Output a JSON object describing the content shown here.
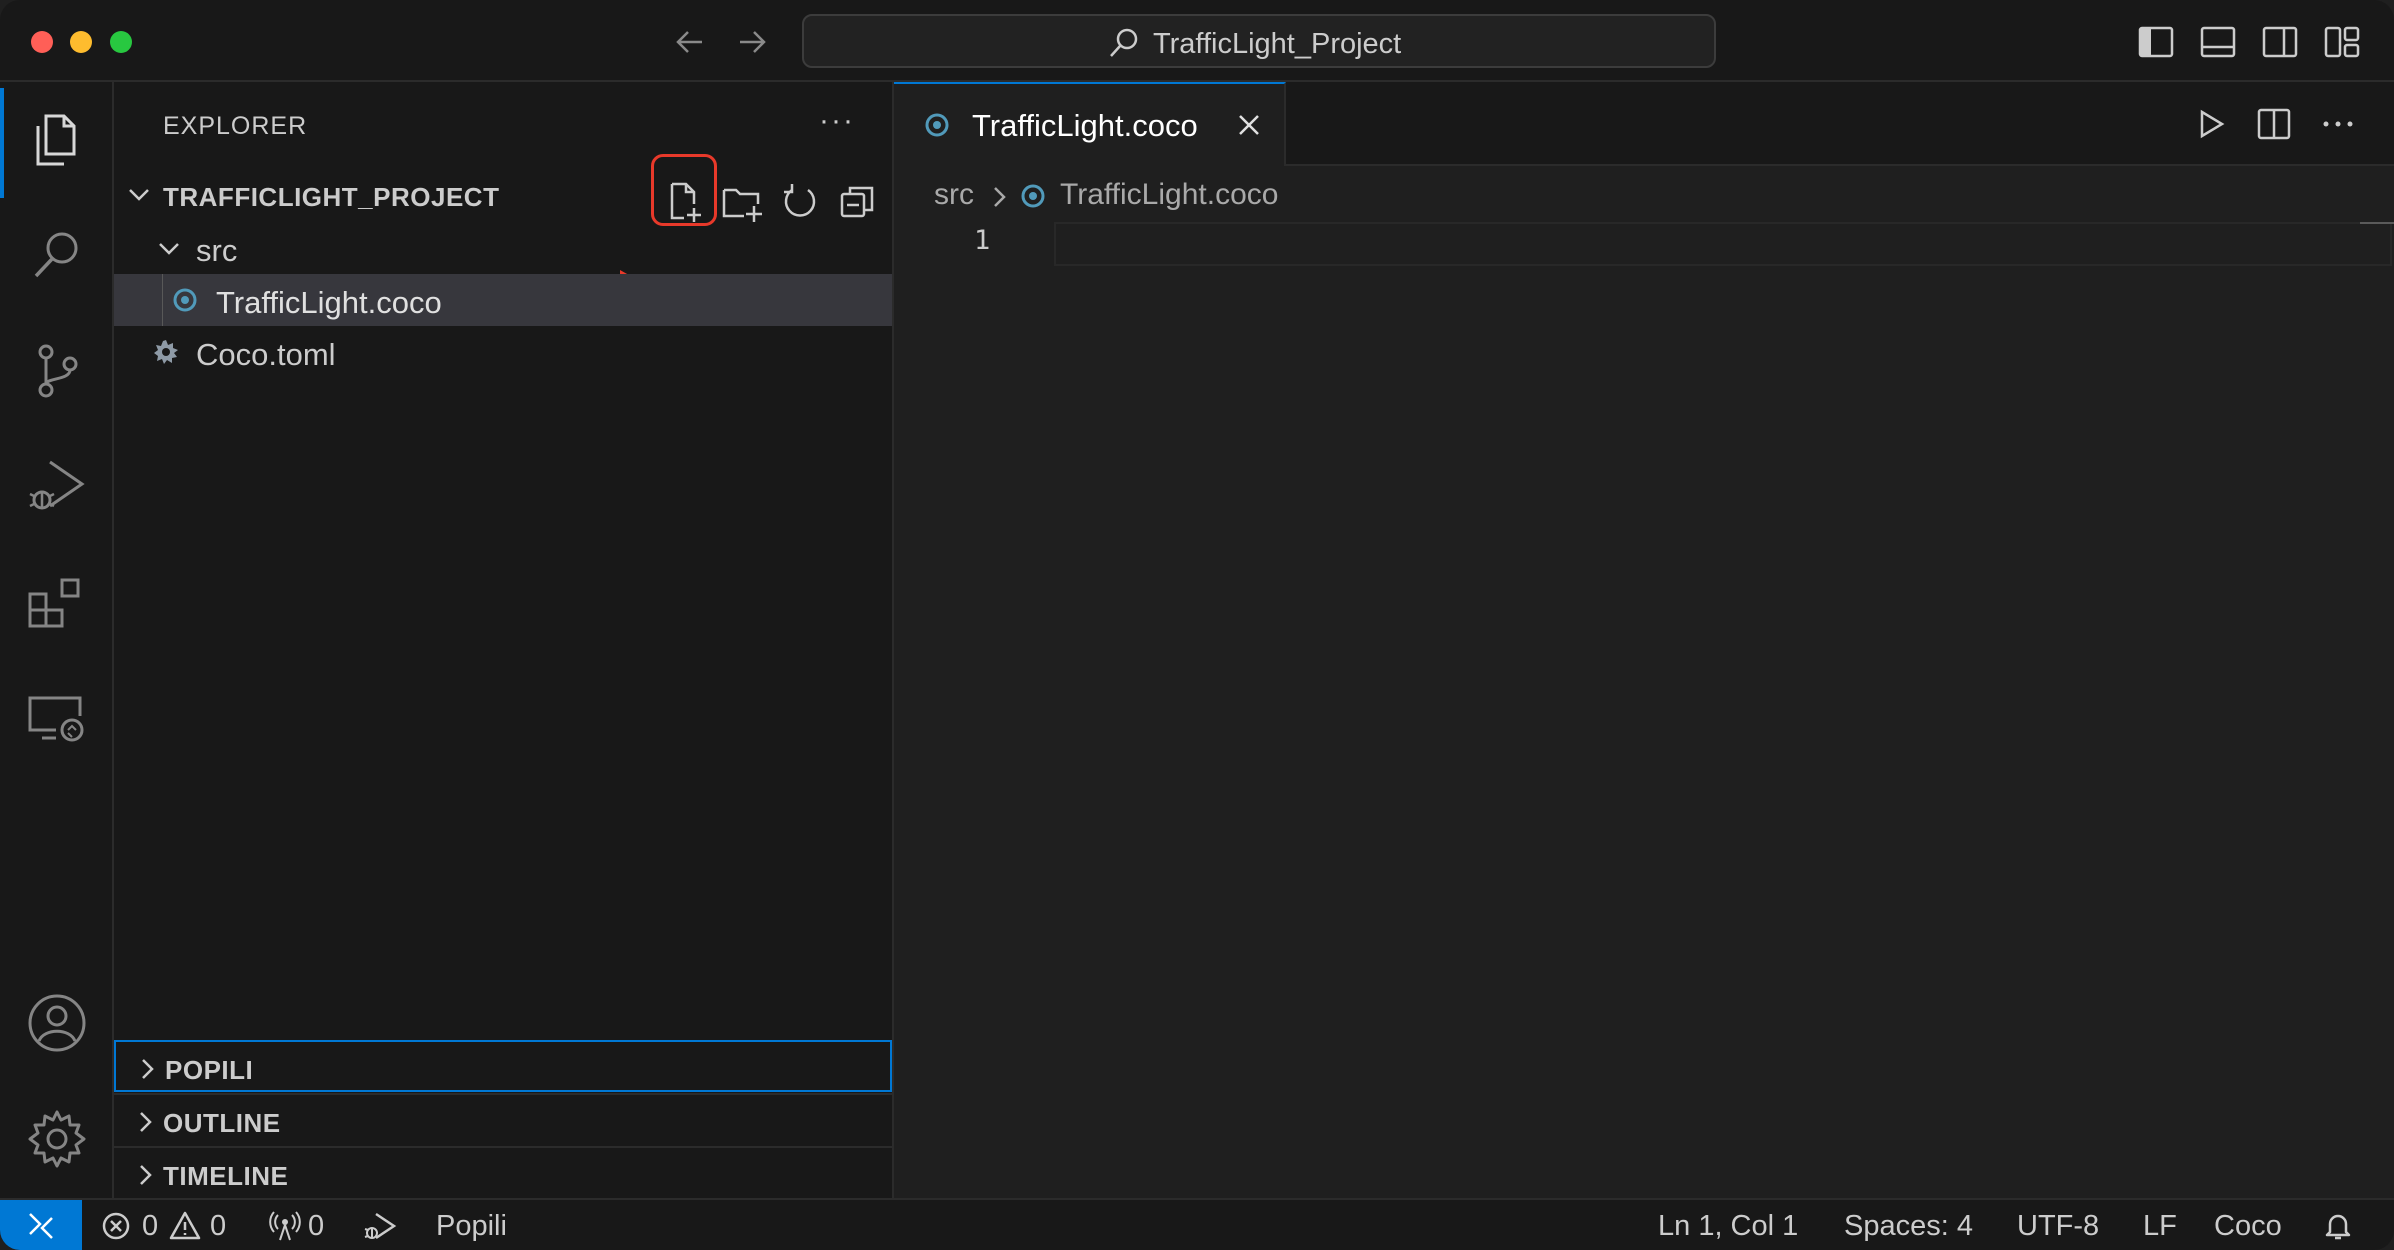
{
  "window": {
    "title": "TrafficLight_Project"
  },
  "activity_bar": {
    "items": [
      "explorer",
      "search",
      "source-control",
      "run-and-debug",
      "extensions",
      "remote-explorer"
    ],
    "bottom": [
      "accounts",
      "manage"
    ]
  },
  "sidebar": {
    "title": "EXPLORER",
    "more": "···",
    "project": "TRAFFICLIGHT_PROJECT",
    "tree": [
      {
        "label": "src",
        "type": "folder",
        "expanded": true
      },
      {
        "label": "TrafficLight.coco",
        "type": "file",
        "selected": true
      },
      {
        "label": "Coco.toml",
        "type": "file"
      }
    ],
    "sections": [
      "POPILI",
      "OUTLINE",
      "TIMELINE"
    ]
  },
  "editor": {
    "tab_label": "TrafficLight.coco",
    "breadcrumb": [
      "src",
      "TrafficLight.coco"
    ],
    "line_number": "1"
  },
  "statusbar": {
    "errors": "0",
    "warnings": "0",
    "ports": "0",
    "debug_target": "Popili",
    "cursor": "Ln 1, Col 1",
    "spaces": "Spaces: 4",
    "encoding": "UTF-8",
    "eol": "LF",
    "language": "Coco"
  },
  "colors": {
    "accent": "#0078d4",
    "highlight": "#e8392a",
    "coco_icon": "#519aba"
  }
}
